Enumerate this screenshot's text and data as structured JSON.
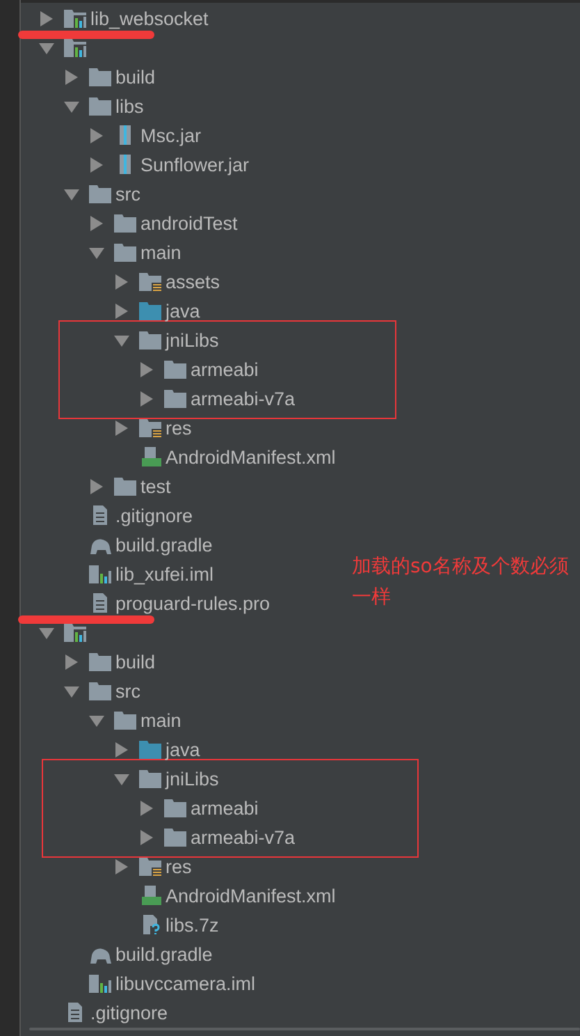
{
  "tree": [
    {
      "kind": "module",
      "label": "lib_websocket",
      "expanded": false
    },
    {
      "kind": "module",
      "redacted": true,
      "expanded": true,
      "children": [
        {
          "kind": "folder",
          "label": "build",
          "expanded": false
        },
        {
          "kind": "folder",
          "label": "libs",
          "expanded": true,
          "children": [
            {
              "kind": "jar",
              "label": "Msc.jar",
              "expanded": false
            },
            {
              "kind": "jar",
              "label": "Sunflower.jar",
              "expanded": false
            }
          ]
        },
        {
          "kind": "folder",
          "label": "src",
          "expanded": true,
          "children": [
            {
              "kind": "folder",
              "label": "androidTest",
              "expanded": false
            },
            {
              "kind": "folder",
              "label": "main",
              "expanded": true,
              "children": [
                {
                  "kind": "resources",
                  "label": "assets",
                  "expanded": false
                },
                {
                  "kind": "source",
                  "label": "java",
                  "expanded": false
                },
                {
                  "kind": "folder",
                  "label": "jniLibs",
                  "expanded": true,
                  "boxed": true,
                  "children": [
                    {
                      "kind": "folder",
                      "label": "armeabi",
                      "expanded": false
                    },
                    {
                      "kind": "folder",
                      "label": "armeabi-v7a",
                      "expanded": false
                    }
                  ]
                },
                {
                  "kind": "resources",
                  "label": "res",
                  "expanded": false
                },
                {
                  "kind": "manifest",
                  "label": "AndroidManifest.xml"
                }
              ]
            },
            {
              "kind": "folder",
              "label": "test",
              "expanded": false
            }
          ]
        },
        {
          "kind": "text",
          "label": ".gitignore"
        },
        {
          "kind": "gradle",
          "label": "build.gradle"
        },
        {
          "kind": "iml",
          "label": "lib_xufei.iml"
        },
        {
          "kind": "text",
          "label": "proguard-rules.pro"
        }
      ]
    },
    {
      "kind": "module",
      "redacted": true,
      "expanded": true,
      "children": [
        {
          "kind": "folder",
          "label": "build",
          "expanded": false
        },
        {
          "kind": "folder",
          "label": "src",
          "expanded": true,
          "children": [
            {
              "kind": "folder",
              "label": "main",
              "expanded": true,
              "children": [
                {
                  "kind": "source",
                  "label": "java",
                  "expanded": false
                },
                {
                  "kind": "folder",
                  "label": "jniLibs",
                  "expanded": true,
                  "boxed": true,
                  "children": [
                    {
                      "kind": "folder",
                      "label": "armeabi",
                      "expanded": false
                    },
                    {
                      "kind": "folder",
                      "label": "armeabi-v7a",
                      "expanded": false
                    }
                  ]
                },
                {
                  "kind": "resources",
                  "label": "res",
                  "expanded": false
                },
                {
                  "kind": "manifest",
                  "label": "AndroidManifest.xml"
                },
                {
                  "kind": "unknown",
                  "label": "libs.7z"
                }
              ]
            }
          ]
        },
        {
          "kind": "gradle",
          "label": "build.gradle"
        },
        {
          "kind": "iml",
          "label": "libuvccamera.iml"
        }
      ]
    },
    {
      "kind": "text",
      "label": ".gitignore"
    }
  ],
  "note": "加载的so名称及个数必须一样"
}
